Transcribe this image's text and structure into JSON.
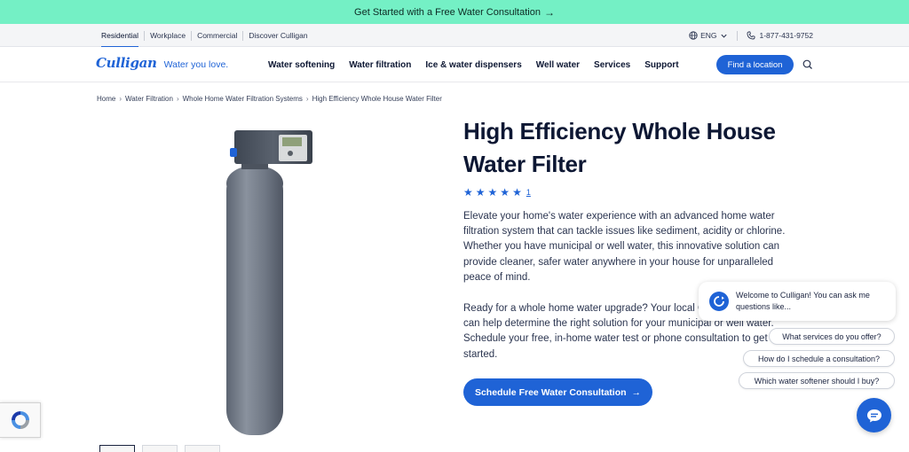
{
  "promo": {
    "text": "Get Started with a Free Water Consultation",
    "arrow_icon": "arrow-right-icon"
  },
  "utility": {
    "tabs": [
      "Residential",
      "Workplace",
      "Commercial",
      "Discover Culligan"
    ],
    "language": "ENG",
    "phone": "1-877-431-9752"
  },
  "nav": {
    "brand": "Culligan",
    "tagline": "Water you love.",
    "links": [
      "Water softening",
      "Water filtration",
      "Ice & water dispensers",
      "Well water",
      "Services",
      "Support"
    ],
    "find_location": "Find a location"
  },
  "breadcrumb": [
    "Home",
    "Water Filtration",
    "Whole Home Water Filtration Systems",
    "High Efficiency Whole House Water Filter"
  ],
  "product": {
    "title": "High Efficiency Whole House Water Filter",
    "rating_stars": 5,
    "review_count": "1",
    "description": "Elevate your home's water experience with an advanced home water filtration system that can tackle issues like sediment, acidity or chlorine. Whether you have municipal or well water, this innovative solution can provide cleaner, safer water anywhere in your house for unparalleled peace of mind.",
    "description2": "Ready for a whole home water upgrade? Your local Culligan Water experts can help determine the right solution for your municipal or well water. Schedule your free, in-home water test or phone consultation to get started.",
    "cta": "Schedule Free Water Consultation"
  },
  "chat": {
    "greeting": "Welcome to Culligan! You can ask me questions like...",
    "suggestions": [
      "What services do you offer?",
      "How do I schedule a consultation?",
      "Which water softener should I buy?"
    ]
  },
  "colors": {
    "accent": "#1f63d6",
    "promo_bg": "#74f0c5",
    "text": "#0d1733"
  }
}
